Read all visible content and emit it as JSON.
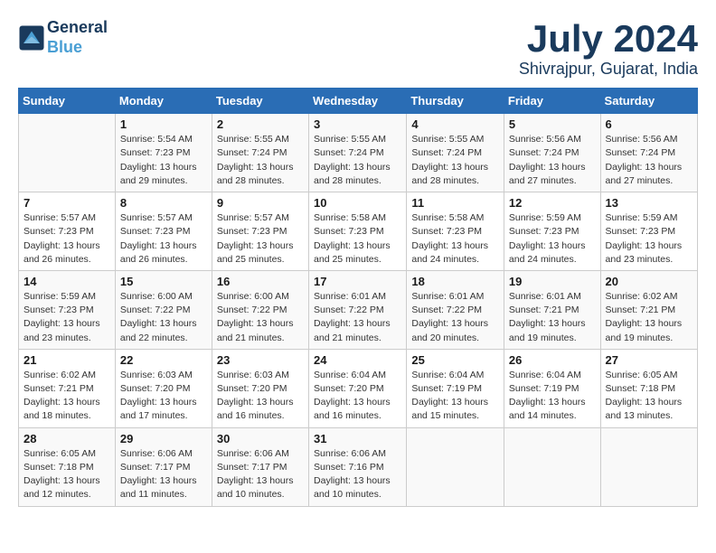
{
  "logo": {
    "line1": "General",
    "line2": "Blue"
  },
  "title": "July 2024",
  "location": "Shivrajpur, Gujarat, India",
  "weekdays": [
    "Sunday",
    "Monday",
    "Tuesday",
    "Wednesday",
    "Thursday",
    "Friday",
    "Saturday"
  ],
  "weeks": [
    [
      {
        "day": "",
        "info": ""
      },
      {
        "day": "1",
        "info": "Sunrise: 5:54 AM\nSunset: 7:23 PM\nDaylight: 13 hours\nand 29 minutes."
      },
      {
        "day": "2",
        "info": "Sunrise: 5:55 AM\nSunset: 7:24 PM\nDaylight: 13 hours\nand 28 minutes."
      },
      {
        "day": "3",
        "info": "Sunrise: 5:55 AM\nSunset: 7:24 PM\nDaylight: 13 hours\nand 28 minutes."
      },
      {
        "day": "4",
        "info": "Sunrise: 5:55 AM\nSunset: 7:24 PM\nDaylight: 13 hours\nand 28 minutes."
      },
      {
        "day": "5",
        "info": "Sunrise: 5:56 AM\nSunset: 7:24 PM\nDaylight: 13 hours\nand 27 minutes."
      },
      {
        "day": "6",
        "info": "Sunrise: 5:56 AM\nSunset: 7:24 PM\nDaylight: 13 hours\nand 27 minutes."
      }
    ],
    [
      {
        "day": "7",
        "info": "Sunrise: 5:57 AM\nSunset: 7:23 PM\nDaylight: 13 hours\nand 26 minutes."
      },
      {
        "day": "8",
        "info": "Sunrise: 5:57 AM\nSunset: 7:23 PM\nDaylight: 13 hours\nand 26 minutes."
      },
      {
        "day": "9",
        "info": "Sunrise: 5:57 AM\nSunset: 7:23 PM\nDaylight: 13 hours\nand 25 minutes."
      },
      {
        "day": "10",
        "info": "Sunrise: 5:58 AM\nSunset: 7:23 PM\nDaylight: 13 hours\nand 25 minutes."
      },
      {
        "day": "11",
        "info": "Sunrise: 5:58 AM\nSunset: 7:23 PM\nDaylight: 13 hours\nand 24 minutes."
      },
      {
        "day": "12",
        "info": "Sunrise: 5:59 AM\nSunset: 7:23 PM\nDaylight: 13 hours\nand 24 minutes."
      },
      {
        "day": "13",
        "info": "Sunrise: 5:59 AM\nSunset: 7:23 PM\nDaylight: 13 hours\nand 23 minutes."
      }
    ],
    [
      {
        "day": "14",
        "info": "Sunrise: 5:59 AM\nSunset: 7:23 PM\nDaylight: 13 hours\nand 23 minutes."
      },
      {
        "day": "15",
        "info": "Sunrise: 6:00 AM\nSunset: 7:22 PM\nDaylight: 13 hours\nand 22 minutes."
      },
      {
        "day": "16",
        "info": "Sunrise: 6:00 AM\nSunset: 7:22 PM\nDaylight: 13 hours\nand 21 minutes."
      },
      {
        "day": "17",
        "info": "Sunrise: 6:01 AM\nSunset: 7:22 PM\nDaylight: 13 hours\nand 21 minutes."
      },
      {
        "day": "18",
        "info": "Sunrise: 6:01 AM\nSunset: 7:22 PM\nDaylight: 13 hours\nand 20 minutes."
      },
      {
        "day": "19",
        "info": "Sunrise: 6:01 AM\nSunset: 7:21 PM\nDaylight: 13 hours\nand 19 minutes."
      },
      {
        "day": "20",
        "info": "Sunrise: 6:02 AM\nSunset: 7:21 PM\nDaylight: 13 hours\nand 19 minutes."
      }
    ],
    [
      {
        "day": "21",
        "info": "Sunrise: 6:02 AM\nSunset: 7:21 PM\nDaylight: 13 hours\nand 18 minutes."
      },
      {
        "day": "22",
        "info": "Sunrise: 6:03 AM\nSunset: 7:20 PM\nDaylight: 13 hours\nand 17 minutes."
      },
      {
        "day": "23",
        "info": "Sunrise: 6:03 AM\nSunset: 7:20 PM\nDaylight: 13 hours\nand 16 minutes."
      },
      {
        "day": "24",
        "info": "Sunrise: 6:04 AM\nSunset: 7:20 PM\nDaylight: 13 hours\nand 16 minutes."
      },
      {
        "day": "25",
        "info": "Sunrise: 6:04 AM\nSunset: 7:19 PM\nDaylight: 13 hours\nand 15 minutes."
      },
      {
        "day": "26",
        "info": "Sunrise: 6:04 AM\nSunset: 7:19 PM\nDaylight: 13 hours\nand 14 minutes."
      },
      {
        "day": "27",
        "info": "Sunrise: 6:05 AM\nSunset: 7:18 PM\nDaylight: 13 hours\nand 13 minutes."
      }
    ],
    [
      {
        "day": "28",
        "info": "Sunrise: 6:05 AM\nSunset: 7:18 PM\nDaylight: 13 hours\nand 12 minutes."
      },
      {
        "day": "29",
        "info": "Sunrise: 6:06 AM\nSunset: 7:17 PM\nDaylight: 13 hours\nand 11 minutes."
      },
      {
        "day": "30",
        "info": "Sunrise: 6:06 AM\nSunset: 7:17 PM\nDaylight: 13 hours\nand 10 minutes."
      },
      {
        "day": "31",
        "info": "Sunrise: 6:06 AM\nSunset: 7:16 PM\nDaylight: 13 hours\nand 10 minutes."
      },
      {
        "day": "",
        "info": ""
      },
      {
        "day": "",
        "info": ""
      },
      {
        "day": "",
        "info": ""
      }
    ]
  ]
}
